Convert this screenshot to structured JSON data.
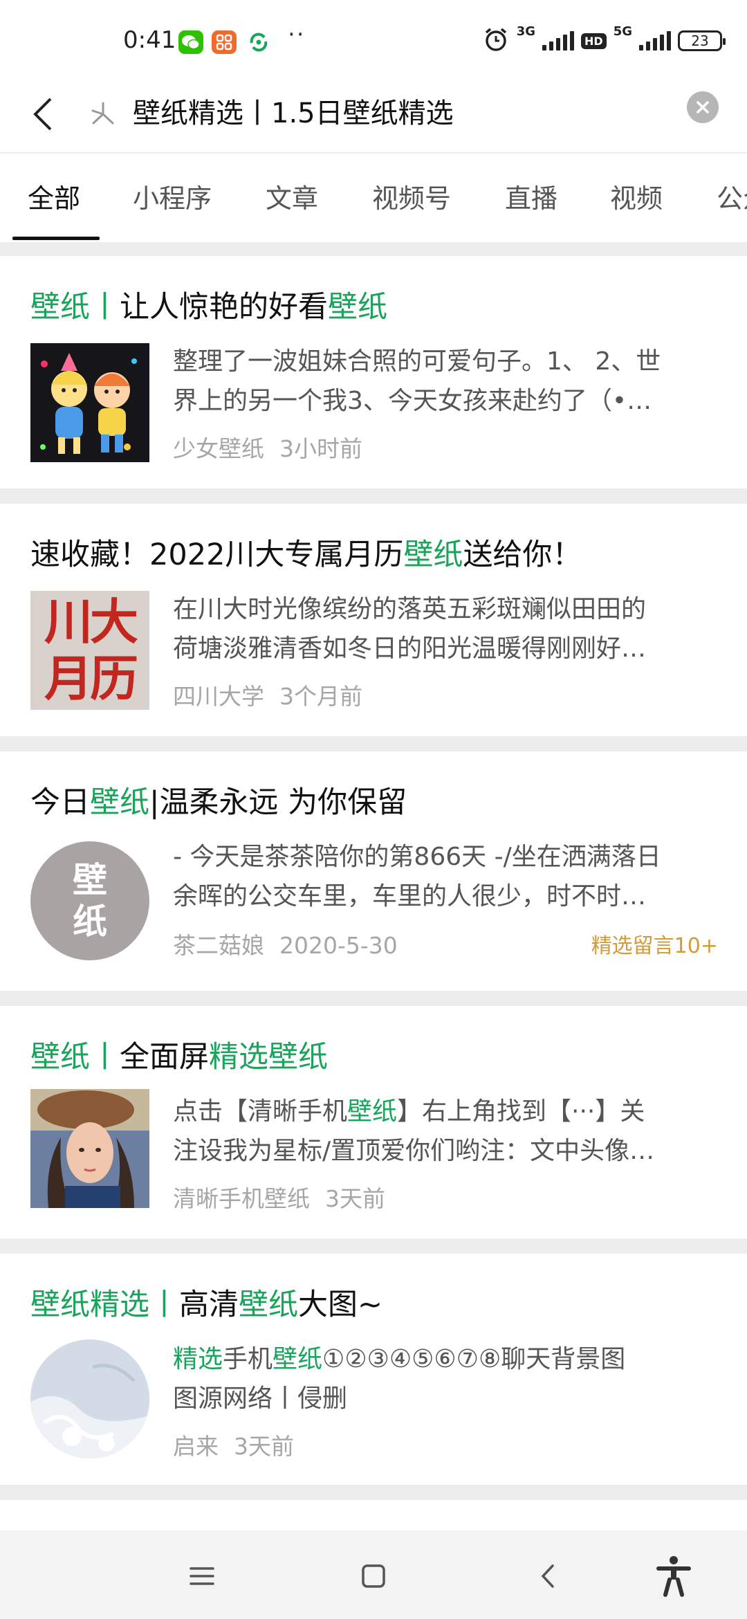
{
  "status_bar": {
    "time": "0:41",
    "net1": "3G",
    "net2": "5G",
    "hd": "HD",
    "battery": "23",
    "dots": "··",
    "app_icons": [
      "wechat-icon",
      "app-grid-icon",
      "sync-app-icon"
    ]
  },
  "search": {
    "query": "壁纸精选丨1.5日壁纸精选"
  },
  "tabs": [
    {
      "label": "全部",
      "active": true
    },
    {
      "label": "小程序",
      "active": false
    },
    {
      "label": "文章",
      "active": false
    },
    {
      "label": "视频号",
      "active": false
    },
    {
      "label": "直播",
      "active": false
    },
    {
      "label": "视频",
      "active": false
    },
    {
      "label": "公众号",
      "active": false
    }
  ],
  "results": [
    {
      "title_parts": [
        {
          "text": "壁纸",
          "hl": true
        },
        {
          "text": "丨",
          "hl": true
        },
        {
          "text": "让人惊艳的好看",
          "hl": false
        },
        {
          "text": "壁纸",
          "hl": true
        }
      ],
      "excerpt_line1": "整理了一波姐妹合照的可爱句子。1、 2、世",
      "excerpt_line2": "界上的另一个我3、今天女孩来赴约了（•…",
      "source": "少女壁纸",
      "time": "3小时前"
    },
    {
      "title_parts": [
        {
          "text": "速收藏！2022川大专属月历",
          "hl": false
        },
        {
          "text": "壁纸",
          "hl": true
        },
        {
          "text": "送给你！",
          "hl": false
        }
      ],
      "thumb_text": [
        "川大",
        "月历"
      ],
      "excerpt_line1": "在川大时光像缤纷的落英五彩斑斓似田田的",
      "excerpt_line2": "荷塘淡雅清香如冬日的阳光温暖得刚刚好…",
      "source": "四川大学",
      "time": "3个月前"
    },
    {
      "title_parts": [
        {
          "text": "今日",
          "hl": false
        },
        {
          "text": "壁纸",
          "hl": true
        },
        {
          "text": "|温柔永远 为你保留",
          "hl": false
        }
      ],
      "thumb_text": [
        "壁",
        "纸"
      ],
      "excerpt_line1": "- 今天是茶茶陪你的第866天 -/坐在洒满落日",
      "excerpt_line2": "余晖的公交车里，车里的人很少，时不时…",
      "source": "茶二菇娘",
      "time": "2020-5-30",
      "badge": "精选留言10+"
    },
    {
      "title_parts": [
        {
          "text": "壁纸",
          "hl": true
        },
        {
          "text": "丨",
          "hl": true
        },
        {
          "text": "全面屏",
          "hl": false
        },
        {
          "text": "精选壁纸",
          "hl": true
        }
      ],
      "excerpt_line1_parts": [
        {
          "text": "点击【清晰手机",
          "hl": false
        },
        {
          "text": "壁纸",
          "hl": true
        },
        {
          "text": "】右上角找到【···】关",
          "hl": false
        }
      ],
      "excerpt_line2": "注设我为星标/置顶爱你们哟注：文中头像…",
      "source": "清晰手机壁纸",
      "time": "3天前"
    },
    {
      "title_parts": [
        {
          "text": "壁纸精选",
          "hl": true
        },
        {
          "text": "丨",
          "hl": true
        },
        {
          "text": "高清",
          "hl": false
        },
        {
          "text": "壁纸",
          "hl": true
        },
        {
          "text": "大图~",
          "hl": false
        }
      ],
      "excerpt_line1_parts": [
        {
          "text": "精选",
          "hl": true
        },
        {
          "text": "手机",
          "hl": false
        },
        {
          "text": "壁纸",
          "hl": true
        },
        {
          "text": "①②③④⑤⑥⑦⑧聊天背景图",
          "hl": false
        }
      ],
      "excerpt_line2": "图源网络丨侵删",
      "source": "启来",
      "time": "3天前"
    }
  ],
  "colors": {
    "highlight": "#1aa35a",
    "badge": "#d39b38",
    "background": "#ededed"
  },
  "nav_icons": [
    "menu-icon",
    "home-square-icon",
    "back-chevron-icon",
    "accessibility-icon"
  ]
}
